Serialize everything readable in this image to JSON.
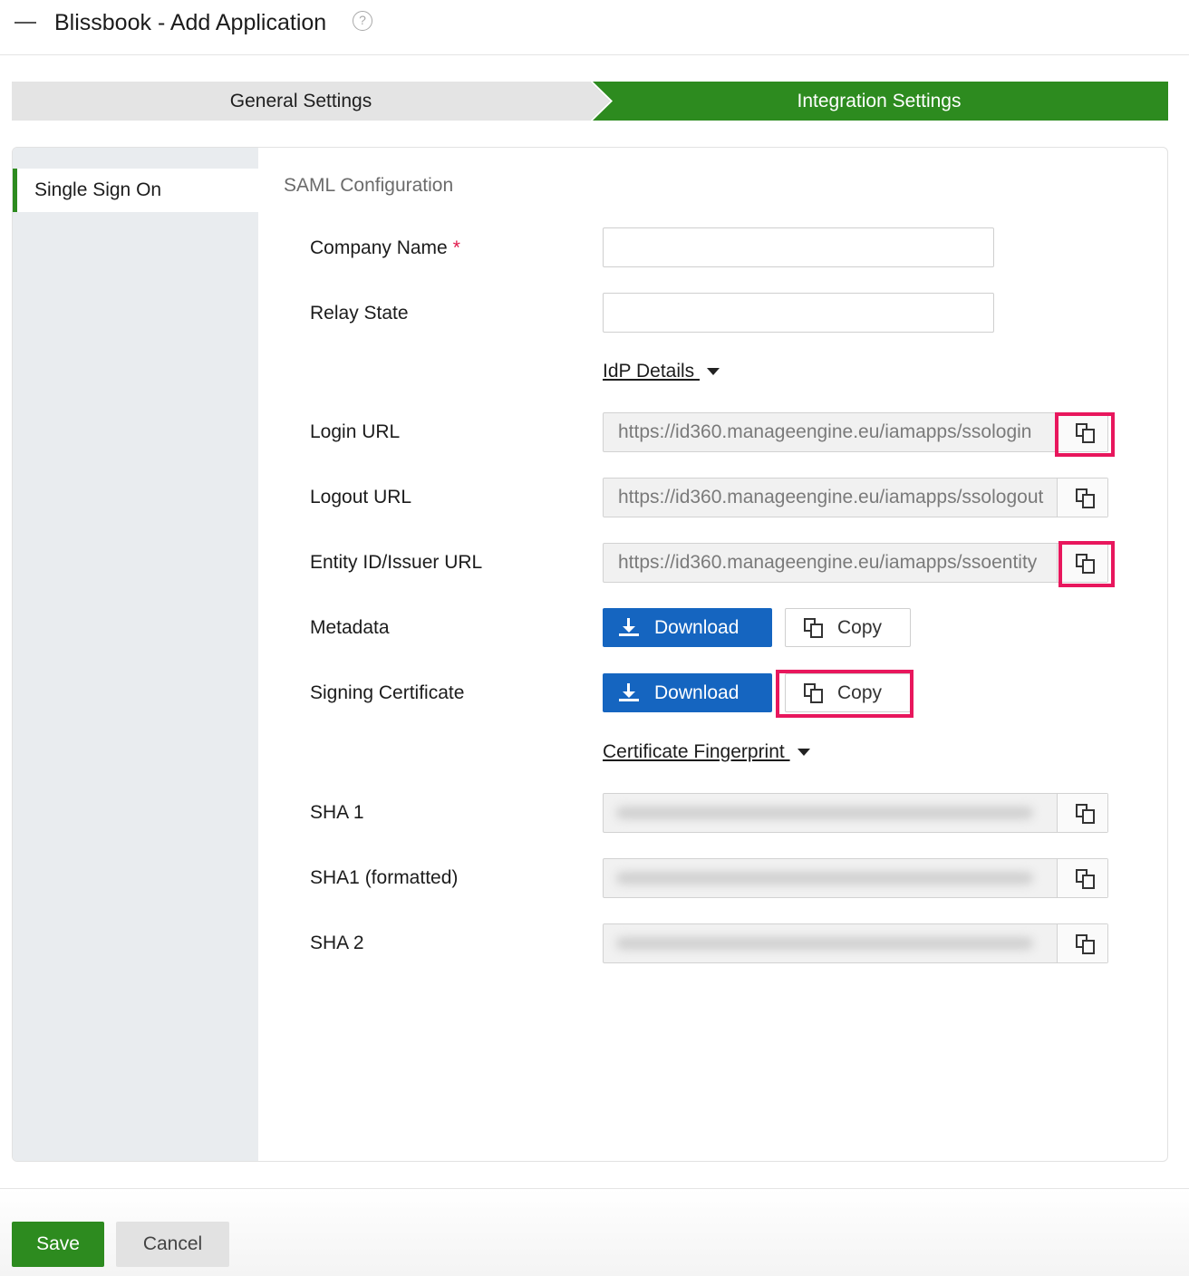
{
  "header": {
    "logo_text": "Blissbook",
    "title": "Blissbook - Add Application",
    "help_icon": "question-circle-icon"
  },
  "steps": {
    "general": "General Settings",
    "integration": "Integration Settings",
    "active": "integration"
  },
  "sidebar": {
    "items": [
      {
        "label": "Single Sign On",
        "active": true
      }
    ]
  },
  "saml": {
    "section_title": "SAML Configuration",
    "company_name": {
      "label": "Company Name",
      "required_mark": "*",
      "value": ""
    },
    "relay_state": {
      "label": "Relay State",
      "value": ""
    },
    "idp_details_toggle": "IdP Details ",
    "login_url": {
      "label": "Login URL",
      "value": "https://id360.manageengine.eu/iamapps/ssologin"
    },
    "logout_url": {
      "label": "Logout URL",
      "value": "https://id360.manageengine.eu/iamapps/ssologout"
    },
    "entity_id": {
      "label": "Entity ID/Issuer URL",
      "value": "https://id360.manageengine.eu/iamapps/ssoentity"
    },
    "metadata": {
      "label": "Metadata",
      "download_label": "Download",
      "copy_label": "Copy"
    },
    "signing_certificate": {
      "label": "Signing Certificate",
      "download_label": "Download",
      "copy_label": "Copy"
    },
    "fingerprint_toggle": "Certificate Fingerprint ",
    "sha1": {
      "label": "SHA 1"
    },
    "sha1_formatted": {
      "label": "SHA1 (formatted)"
    },
    "sha2": {
      "label": "SHA 2"
    }
  },
  "footer": {
    "save_label": "Save",
    "cancel_label": "Cancel"
  },
  "colors": {
    "brand_green": "#2d8b1f",
    "download_blue": "#1565c0",
    "highlight_pink": "#e8175d",
    "required_red": "#e0194b"
  }
}
